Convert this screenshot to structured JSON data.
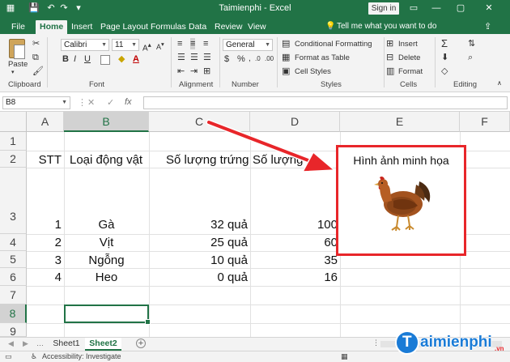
{
  "titlebar": {
    "title": "Taimienphi - Excel",
    "sign_in": "Sign in",
    "quick_access": [
      "save-icon",
      "undo-icon",
      "redo-icon",
      "customize-icon"
    ]
  },
  "tabs": [
    "File",
    "Home",
    "Insert",
    "Page Layout",
    "Formulas",
    "Data",
    "Review",
    "View"
  ],
  "active_tab": "Home",
  "tell_me": "Tell me what you want to do",
  "ribbon": {
    "clipboard": {
      "paste": "Paste",
      "label": "Clipboard"
    },
    "font": {
      "name": "Calibri",
      "size": "11",
      "label": "Font"
    },
    "alignment": {
      "label": "Alignment"
    },
    "number": {
      "format": "General",
      "label": "Number"
    },
    "styles": {
      "conditional": "Conditional Formatting",
      "format_table": "Format as Table",
      "cell_styles": "Cell Styles",
      "label": "Styles"
    },
    "cells": {
      "insert": "Insert",
      "delete": "Delete",
      "format": "Format",
      "label": "Cells"
    },
    "editing": {
      "label": "Editing"
    }
  },
  "formula_bar": {
    "name_box": "B8",
    "formula": ""
  },
  "columns": [
    "A",
    "B",
    "C",
    "D",
    "E",
    "F"
  ],
  "rows": [
    "1",
    "2",
    "3",
    "4",
    "5",
    "6",
    "7",
    "8",
    "9"
  ],
  "sheet": {
    "headers": {
      "A": "STT",
      "B": "Loại động vật",
      "C": "Số lượng trứng",
      "D": "Số lượng",
      "E": "Hình ảnh minh họa"
    },
    "data": [
      {
        "stt": "1",
        "animal": "Gà",
        "eggs": "32 quả",
        "count": "100"
      },
      {
        "stt": "2",
        "animal": "Vịt",
        "eggs": "25 quả",
        "count": "60"
      },
      {
        "stt": "3",
        "animal": "Ngỗng",
        "eggs": "10 quả",
        "count": "35"
      },
      {
        "stt": "4",
        "animal": "Heo",
        "eggs": "0 quả",
        "count": "16"
      }
    ]
  },
  "sheet_tabs": [
    "Sheet1",
    "Sheet2"
  ],
  "active_sheet": "Sheet2",
  "status": {
    "accessibility": "Accessibility: Investigate"
  },
  "watermark": {
    "text": "aimienphi",
    "letter": "T",
    "suffix": ".vn"
  },
  "colors": {
    "excel_green": "#217346",
    "highlight_red": "#e8262a"
  }
}
